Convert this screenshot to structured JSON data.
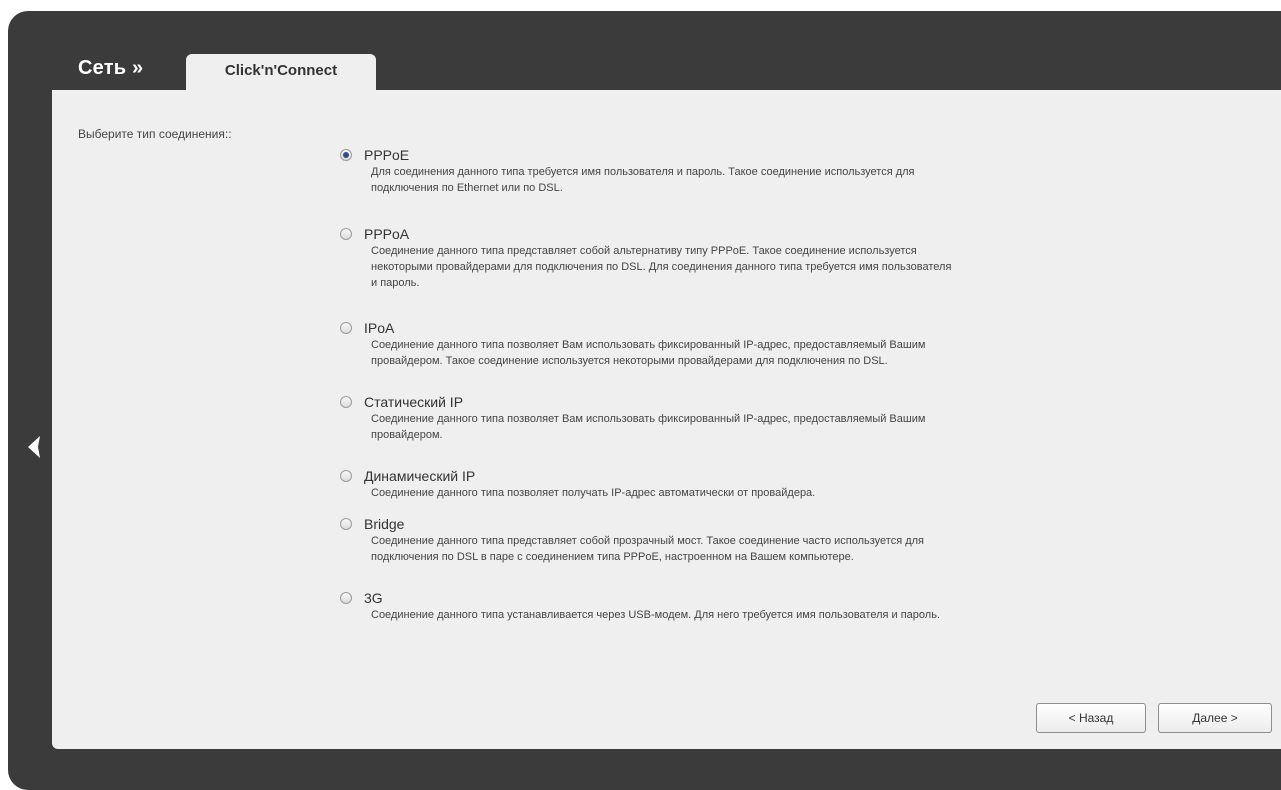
{
  "header": {
    "section_title": "Сеть »",
    "tab_label": "Click'n'Connect"
  },
  "form": {
    "prompt": "Выберите тип соединения::",
    "options": [
      {
        "title": "PPPoE",
        "checked": true,
        "description": [
          "Для соединения данного типа требуется имя пользователя и пароль. Такое соединение используется для",
          "подключения по Ethernet или по DSL."
        ]
      },
      {
        "title": "PPPoA",
        "checked": false,
        "description": [
          "Соединение данного типа представляет собой альтернативу типу PPPoE. Такое соединение используется",
          "некоторыми провайдерами для подключения по DSL. Для соединения данного типа требуется имя пользователя",
          "и пароль."
        ]
      },
      {
        "title": "IPoA",
        "checked": false,
        "description": [
          "Соединение данного типа позволяет Вам использовать фиксированный IP-адрес, предоставляемый Вашим",
          "провайдером. Такое соединение используется некоторыми провайдерами для подключения по DSL."
        ]
      },
      {
        "title": "Статический IP",
        "checked": false,
        "description": [
          "Соединение данного типа позволяет Вам использовать фиксированный IP-адрес, предоставляемый Вашим",
          "провайдером."
        ]
      },
      {
        "title": "Динамический IP",
        "checked": false,
        "description": [
          "Соединение данного типа позволяет получать IP-адрес автоматически от провайдера."
        ]
      },
      {
        "title": "Bridge",
        "checked": false,
        "description": [
          "Соединение данного типа представляет собой прозрачный мост. Такое соединение часто используется для",
          "подключения по DSL в паре с соединением типа PPPoE, настроенном на Вашем компьютере."
        ]
      },
      {
        "title": "3G",
        "checked": false,
        "description": [
          "Соединение данного типа устанавливается через USB-модем. Для него требуется имя пользователя и пароль."
        ]
      }
    ]
  },
  "buttons": {
    "back_label": "< Назад",
    "next_label": "Далее >"
  },
  "icons": {
    "nav_back": "chevron-left-icon"
  },
  "colors": {
    "frame": "#3b3b3b",
    "panel": "#efefef",
    "radio_selected": "#2c4f8a"
  }
}
